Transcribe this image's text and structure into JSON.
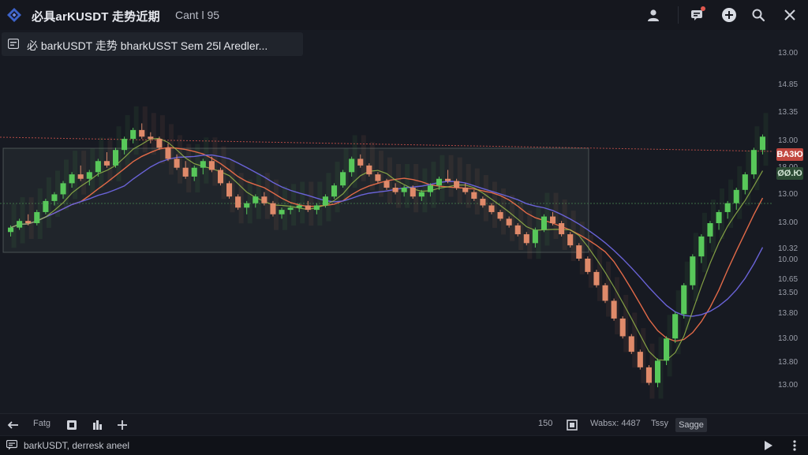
{
  "header": {
    "title": "必具arKUSDT 走势近期",
    "extra": "Cant l 95",
    "icons": [
      "user-icon",
      "notification-icon",
      "add-icon",
      "search-icon",
      "close-icon"
    ]
  },
  "legend": {
    "text": "必 barkUSDT 走势   bharkUSST Sem 25l Aredler..."
  },
  "price_axis": {
    "labels": [
      "13.00",
      "14.85",
      "13.35",
      "13.00",
      "18.00",
      "13.00",
      "13.00",
      "10.32",
      "10.00",
      "10.65",
      "13.50",
      "13.80",
      "13.00",
      "13.80",
      "13.00"
    ],
    "tags": [
      {
        "text": "BA3Ю",
        "bg": "#c2473f",
        "fg": "#ffffff"
      },
      {
        "text": "ØØ.Ю",
        "bg": "#2b4a34",
        "fg": "#cfe3d2"
      }
    ]
  },
  "bottom_toolbar": {
    "timeframe": "Fatg",
    "value": "150",
    "info": "Wabsx: 4487",
    "mode": "Tssy",
    "scale": "Sagge"
  },
  "status": {
    "text": "barkUSDT,  derresk  aneel"
  },
  "colors": {
    "up": "#58c85a",
    "down": "#e08a6a",
    "ma_orange": "#e26a48",
    "ma_purple": "#6a63d8",
    "ma_green": "#9ec04c",
    "accent_red": "#c2473f"
  },
  "chart_data": {
    "type": "candlestick",
    "symbol": "barkUSDT",
    "ohlc": [
      [
        8.6,
        8.9,
        8.4,
        8.8
      ],
      [
        8.8,
        9.2,
        8.7,
        9.1
      ],
      [
        9.1,
        9.4,
        8.9,
        9.0
      ],
      [
        9.0,
        9.6,
        8.9,
        9.5
      ],
      [
        9.5,
        10.1,
        9.4,
        10.0
      ],
      [
        10.0,
        10.4,
        9.8,
        10.3
      ],
      [
        10.3,
        10.9,
        10.1,
        10.8
      ],
      [
        10.8,
        11.3,
        10.6,
        11.2
      ],
      [
        11.2,
        11.6,
        10.9,
        11.0
      ],
      [
        11.0,
        11.4,
        10.7,
        11.3
      ],
      [
        11.3,
        11.9,
        11.1,
        11.8
      ],
      [
        11.8,
        12.2,
        11.5,
        11.6
      ],
      [
        11.6,
        12.4,
        11.5,
        12.3
      ],
      [
        12.3,
        12.9,
        12.1,
        12.8
      ],
      [
        12.8,
        13.3,
        12.6,
        13.2
      ],
      [
        13.2,
        13.5,
        12.8,
        12.9
      ],
      [
        12.9,
        13.1,
        12.6,
        12.8
      ],
      [
        12.8,
        12.9,
        12.3,
        12.4
      ],
      [
        12.4,
        12.6,
        11.8,
        11.9
      ],
      [
        11.9,
        12.1,
        11.4,
        11.5
      ],
      [
        11.5,
        11.8,
        11.0,
        11.1
      ],
      [
        11.1,
        11.6,
        10.9,
        11.5
      ],
      [
        11.5,
        11.9,
        11.2,
        11.8
      ],
      [
        11.8,
        12.0,
        11.3,
        11.4
      ],
      [
        11.4,
        11.5,
        10.7,
        10.8
      ],
      [
        10.8,
        10.9,
        10.1,
        10.2
      ],
      [
        10.2,
        10.3,
        9.6,
        9.7
      ],
      [
        9.7,
        10.0,
        9.4,
        9.9
      ],
      [
        9.9,
        10.3,
        9.7,
        10.2
      ],
      [
        10.2,
        10.4,
        9.8,
        9.9
      ],
      [
        9.9,
        10.0,
        9.3,
        9.4
      ],
      [
        9.4,
        9.7,
        9.2,
        9.6
      ],
      [
        9.6,
        9.8,
        9.4,
        9.7
      ],
      [
        9.7,
        9.9,
        9.5,
        9.8
      ],
      [
        9.8,
        10.0,
        9.5,
        9.6
      ],
      [
        9.6,
        9.9,
        9.4,
        9.8
      ],
      [
        9.8,
        10.3,
        9.7,
        10.2
      ],
      [
        10.2,
        10.8,
        10.1,
        10.7
      ],
      [
        10.7,
        11.4,
        10.6,
        11.3
      ],
      [
        11.3,
        12.0,
        11.1,
        11.9
      ],
      [
        11.9,
        12.1,
        11.5,
        11.6
      ],
      [
        11.6,
        11.7,
        11.1,
        11.2
      ],
      [
        11.2,
        11.3,
        10.8,
        10.9
      ],
      [
        10.9,
        11.0,
        10.5,
        10.6
      ],
      [
        10.6,
        10.8,
        10.3,
        10.4
      ],
      [
        10.4,
        10.7,
        10.2,
        10.6
      ],
      [
        10.6,
        10.7,
        10.1,
        10.2
      ],
      [
        10.2,
        10.5,
        10.0,
        10.4
      ],
      [
        10.4,
        10.8,
        10.2,
        10.7
      ],
      [
        10.7,
        11.1,
        10.5,
        11.0
      ],
      [
        11.0,
        11.4,
        10.8,
        10.9
      ],
      [
        10.9,
        11.0,
        10.5,
        10.6
      ],
      [
        10.6,
        10.8,
        10.3,
        10.4
      ],
      [
        10.4,
        10.5,
        10.0,
        10.1
      ],
      [
        10.1,
        10.2,
        9.7,
        9.8
      ],
      [
        9.8,
        9.9,
        9.4,
        9.5
      ],
      [
        9.5,
        9.6,
        9.1,
        9.2
      ],
      [
        9.2,
        9.3,
        8.8,
        8.9
      ],
      [
        8.9,
        9.0,
        8.4,
        8.5
      ],
      [
        8.5,
        8.6,
        8.0,
        8.1
      ],
      [
        8.1,
        8.8,
        7.9,
        8.7
      ],
      [
        8.7,
        9.4,
        8.6,
        9.3
      ],
      [
        9.3,
        9.5,
        8.9,
        9.0
      ],
      [
        9.0,
        9.1,
        8.4,
        8.5
      ],
      [
        8.5,
        8.6,
        7.9,
        8.0
      ],
      [
        8.0,
        8.1,
        7.3,
        7.4
      ],
      [
        7.4,
        7.5,
        6.7,
        6.8
      ],
      [
        6.8,
        6.9,
        6.1,
        6.2
      ],
      [
        6.2,
        6.3,
        5.4,
        5.5
      ],
      [
        5.5,
        5.6,
        4.6,
        4.7
      ],
      [
        4.7,
        4.8,
        3.8,
        3.9
      ],
      [
        3.9,
        4.0,
        3.1,
        3.2
      ],
      [
        3.2,
        3.3,
        2.4,
        2.5
      ],
      [
        2.5,
        2.6,
        1.7,
        1.8
      ],
      [
        1.8,
        2.9,
        1.6,
        2.8
      ],
      [
        2.8,
        3.9,
        2.6,
        3.8
      ],
      [
        3.8,
        5.0,
        3.6,
        4.9
      ],
      [
        4.9,
        6.3,
        4.7,
        6.2
      ],
      [
        6.2,
        7.6,
        6.0,
        7.5
      ],
      [
        7.5,
        8.5,
        7.2,
        8.4
      ],
      [
        8.4,
        9.1,
        8.1,
        9.0
      ],
      [
        9.0,
        9.6,
        8.7,
        9.5
      ],
      [
        9.5,
        10.0,
        9.2,
        9.9
      ],
      [
        9.9,
        10.6,
        9.6,
        10.5
      ],
      [
        10.5,
        11.3,
        10.3,
        11.2
      ],
      [
        11.2,
        12.4,
        11.0,
        12.3
      ],
      [
        12.3,
        13.0,
        12.1,
        12.9
      ]
    ],
    "price_range": [
      1,
      17
    ],
    "moving_averages": [
      "orange",
      "purple",
      "green"
    ],
    "grid": false
  }
}
